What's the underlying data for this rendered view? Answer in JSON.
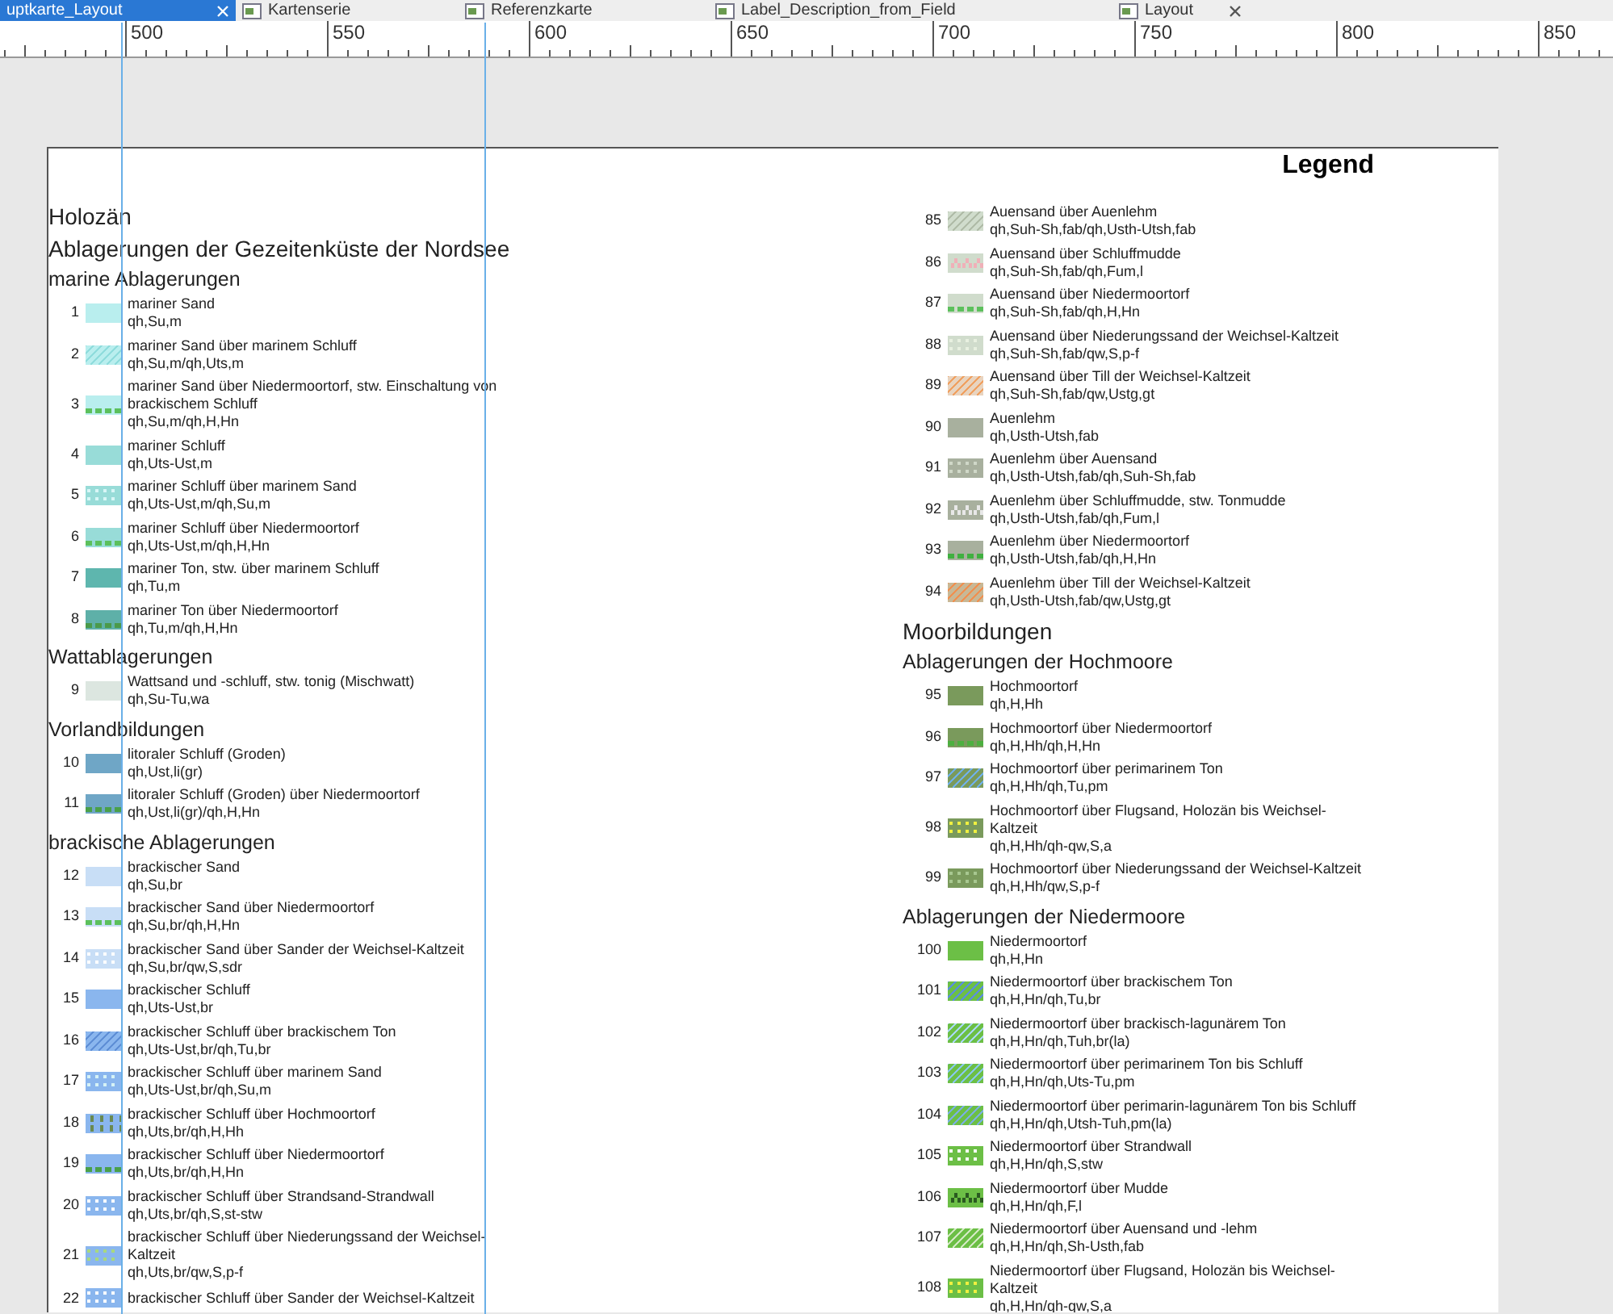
{
  "tabs": [
    {
      "label": "uptkarte_Layout",
      "selected": true,
      "icon": false,
      "closable": true
    },
    {
      "label": "Kartenserie",
      "selected": false,
      "icon": true,
      "closable": false
    },
    {
      "label": "Referenzkarte",
      "selected": false,
      "icon": true,
      "closable": false
    },
    {
      "label": "Label_Description_from_Field",
      "selected": false,
      "icon": true,
      "closable": false
    },
    {
      "label": "Layout",
      "selected": false,
      "icon": true,
      "closable": true
    }
  ],
  "ruler": {
    "labels": [
      "500",
      "550",
      "600",
      "650",
      "700",
      "750",
      "800",
      "850"
    ]
  },
  "legend": {
    "title": "Legend",
    "left_column": [
      {
        "kind": "title",
        "text": "Holozän"
      },
      {
        "kind": "title",
        "text": "Ablagerungen der Gezeitenküste der Nordsee"
      },
      {
        "kind": "subtitle",
        "text": "marine Ablagerungen"
      },
      {
        "kind": "item",
        "number": "1",
        "label": "mariner Sand",
        "code": "qh,Su,m",
        "color": "#b9eeee"
      },
      {
        "kind": "item",
        "number": "2",
        "label": "mariner Sand über marinem Schluff",
        "code": "qh,Su,m/qh,Uts,m",
        "color": "#b9eeee",
        "pattern": {
          "kind": "hatch",
          "color": "#8fdcdc"
        }
      },
      {
        "kind": "item",
        "number": "3",
        "label": "mariner Sand über Niedermoortorf, stw. Einschaltung von brackischem Schluff",
        "code": "qh,Su,m/qh,H,Hn",
        "color": "#b9eeee",
        "pattern": {
          "kind": "dashes",
          "color": "#5cc05c"
        }
      },
      {
        "kind": "item",
        "number": "4",
        "label": "mariner Schluff",
        "code": "qh,Uts-Ust,m",
        "color": "#98dcd8"
      },
      {
        "kind": "item",
        "number": "5",
        "label": "mariner Schluff über marinem Sand",
        "code": "qh,Uts-Ust,m/qh,Su,m",
        "color": "#98dcd8",
        "pattern": {
          "kind": "dots",
          "color": "#d8f6f6"
        }
      },
      {
        "kind": "item",
        "number": "6",
        "label": "mariner Schluff über Niedermoortorf",
        "code": "qh,Uts-Ust,m/qh,H,Hn",
        "color": "#98dcd8",
        "pattern": {
          "kind": "dashes",
          "color": "#5cc05c"
        }
      },
      {
        "kind": "item",
        "number": "7",
        "label": "mariner Ton, stw. über marinem Schluff",
        "code": "qh,Tu,m",
        "color": "#5eb6ae"
      },
      {
        "kind": "item",
        "number": "8",
        "label": "mariner Ton über Niedermoortorf",
        "code": "qh,Tu,m/qh,H,Hn",
        "color": "#5eb0a8",
        "pattern": {
          "kind": "dashes",
          "color": "#4a9a4a"
        }
      },
      {
        "kind": "subtitle",
        "text": "Wattablagerungen"
      },
      {
        "kind": "item",
        "number": "9",
        "label": "Wattsand und -schluff, stw. tonig (Mischwatt)",
        "code": "qh,Su-Tu,wa",
        "color": "#dce6e0"
      },
      {
        "kind": "subtitle",
        "text": "Vorlandbildungen"
      },
      {
        "kind": "item",
        "number": "10",
        "label": "litoraler Schluff (Groden)",
        "code": "qh,Ust,li(gr)",
        "color": "#6fa6c6"
      },
      {
        "kind": "item",
        "number": "11",
        "label": "litoraler Schluff (Groden) über Niedermoortorf",
        "code": "qh,Ust,li(gr)/qh,H,Hn",
        "color": "#6fa6c6",
        "pattern": {
          "kind": "dashes",
          "color": "#4aa04a"
        }
      },
      {
        "kind": "subtitle",
        "text": "brackische Ablagerungen"
      },
      {
        "kind": "item",
        "number": "12",
        "label": "brackischer Sand",
        "code": "qh,Su,br",
        "color": "#c8def6"
      },
      {
        "kind": "item",
        "number": "13",
        "label": "brackischer Sand über Niedermoortorf",
        "code": "qh,Su,br/qh,H,Hn",
        "color": "#c8def6",
        "pattern": {
          "kind": "dashes",
          "color": "#5cc05c"
        }
      },
      {
        "kind": "item",
        "number": "14",
        "label": "brackischer Sand über Sander der Weichsel-Kaltzeit",
        "code": "qh,Su,br/qw,S,sdr",
        "color": "#c8def6",
        "pattern": {
          "kind": "dots",
          "color": "#ffffff"
        }
      },
      {
        "kind": "item",
        "number": "15",
        "label": "brackischer Schluff",
        "code": "qh,Uts-Ust,br",
        "color": "#8ab6ee"
      },
      {
        "kind": "item",
        "number": "16",
        "label": "brackischer Schluff über brackischem Ton",
        "code": "qh,Uts-Ust,br/qh,Tu,br",
        "color": "#8ab6ee",
        "pattern": {
          "kind": "hatch",
          "color": "#5f8fd6"
        }
      },
      {
        "kind": "item",
        "number": "17",
        "label": "brackischer Schluff über marinem Sand",
        "code": "qh,Uts-Ust,br/qh,Su,m",
        "color": "#8ab6ee",
        "pattern": {
          "kind": "dots",
          "color": "#d6f2f6"
        }
      },
      {
        "kind": "item",
        "number": "18",
        "label": "brackischer Schluff über Hochmoortorf",
        "code": "qh,Uts,br/qh,H,Hh",
        "color": "#8ab6ee",
        "pattern": {
          "kind": "ticks",
          "color": "#6a8a50"
        }
      },
      {
        "kind": "item",
        "number": "19",
        "label": "brackischer Schluff über Niedermoortorf",
        "code": "qh,Uts,br/qh,H,Hn",
        "color": "#8ab6ee",
        "pattern": {
          "kind": "dashes",
          "color": "#4aa04a"
        }
      },
      {
        "kind": "item",
        "number": "20",
        "label": "brackischer Schluff über Strandsand-Strandwall",
        "code": "qh,Uts,br/qh,S,st-stw",
        "color": "#8ab6ee",
        "pattern": {
          "kind": "dots",
          "color": "#ffffff"
        }
      },
      {
        "kind": "item",
        "number": "21",
        "label": "brackischer Schluff über Niederungssand der Weichsel-Kaltzeit",
        "code": "qh,Uts,br/qw,S,p-f",
        "color": "#8ab6ee",
        "pattern": {
          "kind": "dots",
          "color": "#a8d880"
        }
      },
      {
        "kind": "item",
        "number": "22",
        "label": "brackischer Schluff über Sander der Weichsel-Kaltzeit",
        "color": "#8ab6ee",
        "pattern": {
          "kind": "dots",
          "color": "#ffffff"
        }
      }
    ],
    "right_column": [
      {
        "kind": "item",
        "number": "85",
        "label": "Auensand über Auenlehm",
        "code": "qh,Suh-Sh,fab/qh,Usth-Utsh,fab",
        "color": "#d0dccc",
        "pattern": {
          "kind": "hatch",
          "color": "#b0bca8"
        }
      },
      {
        "kind": "item",
        "number": "86",
        "label": "Auensand über Schluffmudde",
        "code": "qh,Suh-Sh,fab/qh,Fum,l",
        "color": "#d0dccc",
        "pattern": {
          "kind": "carets",
          "color": "#f0b0b8"
        }
      },
      {
        "kind": "item",
        "number": "87",
        "label": "Auensand über Niedermoortorf",
        "code": "qh,Suh-Sh,fab/qh,H,Hn",
        "color": "#d0dccc",
        "pattern": {
          "kind": "dashes",
          "color": "#5cc05c"
        }
      },
      {
        "kind": "item",
        "number": "88",
        "label": "Auensand über Niederungssand der Weichsel-Kaltzeit",
        "code": "qh,Suh-Sh,fab/qw,S,p-f",
        "color": "#d0dccc",
        "pattern": {
          "kind": "dots",
          "color": "#e8f0e0"
        }
      },
      {
        "kind": "item",
        "number": "89",
        "label": "Auensand über Till der Weichsel-Kaltzeit",
        "code": "qh,Suh-Sh,fab/qw,Ustg,gt",
        "color": "#e8d4c0",
        "pattern": {
          "kind": "hatch",
          "color": "#f0a060"
        }
      },
      {
        "kind": "item",
        "number": "90",
        "label": "Auenlehm",
        "code": "qh,Usth-Utsh,fab",
        "color": "#a8b09e"
      },
      {
        "kind": "item",
        "number": "91",
        "label": "Auenlehm über Auensand",
        "code": "qh,Usth-Utsh,fab/qh,Suh-Sh,fab",
        "color": "#a8b09e",
        "pattern": {
          "kind": "dots",
          "color": "#d0d8c8"
        }
      },
      {
        "kind": "item",
        "number": "92",
        "label": "Auenlehm über Schluffmudde, stw. Tonmudde",
        "code": "qh,Usth-Utsh,fab/qh,Fum,l",
        "color": "#a8b09e",
        "pattern": {
          "kind": "carets",
          "color": "#e8e8e8"
        }
      },
      {
        "kind": "item",
        "number": "93",
        "label": "Auenlehm über Niedermoortorf",
        "code": "qh,Usth-Utsh,fab/qh,H,Hn",
        "color": "#a8b09e",
        "pattern": {
          "kind": "dashes",
          "color": "#40b040"
        }
      },
      {
        "kind": "item",
        "number": "94",
        "label": "Auenlehm über Till der Weichsel-Kaltzeit",
        "code": "qh,Usth-Utsh,fab/qw,Ustg,gt",
        "color": "#c8b896",
        "pattern": {
          "kind": "hatch",
          "color": "#f09050"
        }
      },
      {
        "kind": "title",
        "text": "Moorbildungen"
      },
      {
        "kind": "subtitle",
        "text": "Ablagerungen der Hochmoore"
      },
      {
        "kind": "item",
        "number": "95",
        "label": "Hochmoortorf",
        "code": "qh,H,Hh",
        "color": "#7a9a5c"
      },
      {
        "kind": "item",
        "number": "96",
        "label": "Hochmoortorf über Niedermoortorf",
        "code": "qh,H,Hh/qh,H,Hn",
        "color": "#7a9a5c",
        "pattern": {
          "kind": "dashes",
          "color": "#4cb040"
        }
      },
      {
        "kind": "item",
        "number": "97",
        "label": "Hochmoortorf über perimarinem Ton",
        "code": "qh,H,Hh/qh,Tu,pm",
        "color": "#7a9a5c",
        "pattern": {
          "kind": "hatch",
          "color": "#70b0e8"
        }
      },
      {
        "kind": "item",
        "number": "98",
        "label": "Hochmoortorf über Flugsand, Holozän bis Weichsel-Kaltzeit",
        "code": "qh,H,Hh/qh-qw,S,a",
        "color": "#7a9a5c",
        "pattern": {
          "kind": "dots",
          "color": "#f0f040"
        }
      },
      {
        "kind": "item",
        "number": "99",
        "label": "Hochmoortorf über Niederungssand der Weichsel-Kaltzeit",
        "code": "qh,H,Hh/qw,S,p-f",
        "color": "#7a9a5c",
        "pattern": {
          "kind": "dots",
          "color": "#a8c890"
        }
      },
      {
        "kind": "subtitle",
        "text": "Ablagerungen der Niedermoore"
      },
      {
        "kind": "item",
        "number": "100",
        "label": "Niedermoortorf",
        "code": "qh,H,Hn",
        "color": "#6cbf46"
      },
      {
        "kind": "item",
        "number": "101",
        "label": "Niedermoortorf über brackischem Ton",
        "code": "qh,H,Hn/qh,Tu,br",
        "color": "#6cbf46",
        "pattern": {
          "kind": "hatch",
          "color": "#5a8ee0"
        }
      },
      {
        "kind": "item",
        "number": "102",
        "label": "Niedermoortorf über brackisch-lagunärem Ton",
        "code": "qh,H,Hn/qh,Tuh,br(la)",
        "color": "#6cbf46",
        "pattern": {
          "kind": "hatch",
          "color": "#a8d8f0"
        }
      },
      {
        "kind": "item",
        "number": "103",
        "label": "Niedermoortorf über perimarinem Ton bis Schluff",
        "code": "qh,H,Hn/qh,Uts-Tu,pm",
        "color": "#6cbf46",
        "pattern": {
          "kind": "hatch",
          "color": "#88c8e8"
        }
      },
      {
        "kind": "item",
        "number": "104",
        "label": "Niedermoortorf über perimarin-lagunärem Ton bis Schluff",
        "code": "qh,H,Hn/qh,Utsh-Tuh,pm(la)",
        "color": "#6cbf46",
        "pattern": {
          "kind": "hatch",
          "color": "#7ab0e0"
        }
      },
      {
        "kind": "item",
        "number": "105",
        "label": "Niedermoortorf über Strandwall",
        "code": "qh,H,Hn/qh,S,stw",
        "color": "#6cbf46",
        "pattern": {
          "kind": "dots",
          "color": "#ffffff"
        }
      },
      {
        "kind": "item",
        "number": "106",
        "label": "Niedermoortorf über Mudde",
        "code": "qh,H,Hn/qh,F,l",
        "color": "#6cbf46",
        "pattern": {
          "kind": "carets",
          "color": "#2a5a20"
        }
      },
      {
        "kind": "item",
        "number": "107",
        "label": "Niedermoortorf über Auensand und -lehm",
        "code": "qh,H,Hn/qh,Sh-Usth,fab",
        "color": "#6cbf46",
        "pattern": {
          "kind": "hatch",
          "color": "#d0e8c0"
        }
      },
      {
        "kind": "item",
        "number": "108",
        "label": "Niedermoortorf über Flugsand, Holozän bis Weichsel-Kaltzeit",
        "code": "qh,H,Hn/qh-qw,S,a",
        "color": "#6cbf46",
        "pattern": {
          "kind": "dots",
          "color": "#f0f040"
        }
      }
    ]
  }
}
